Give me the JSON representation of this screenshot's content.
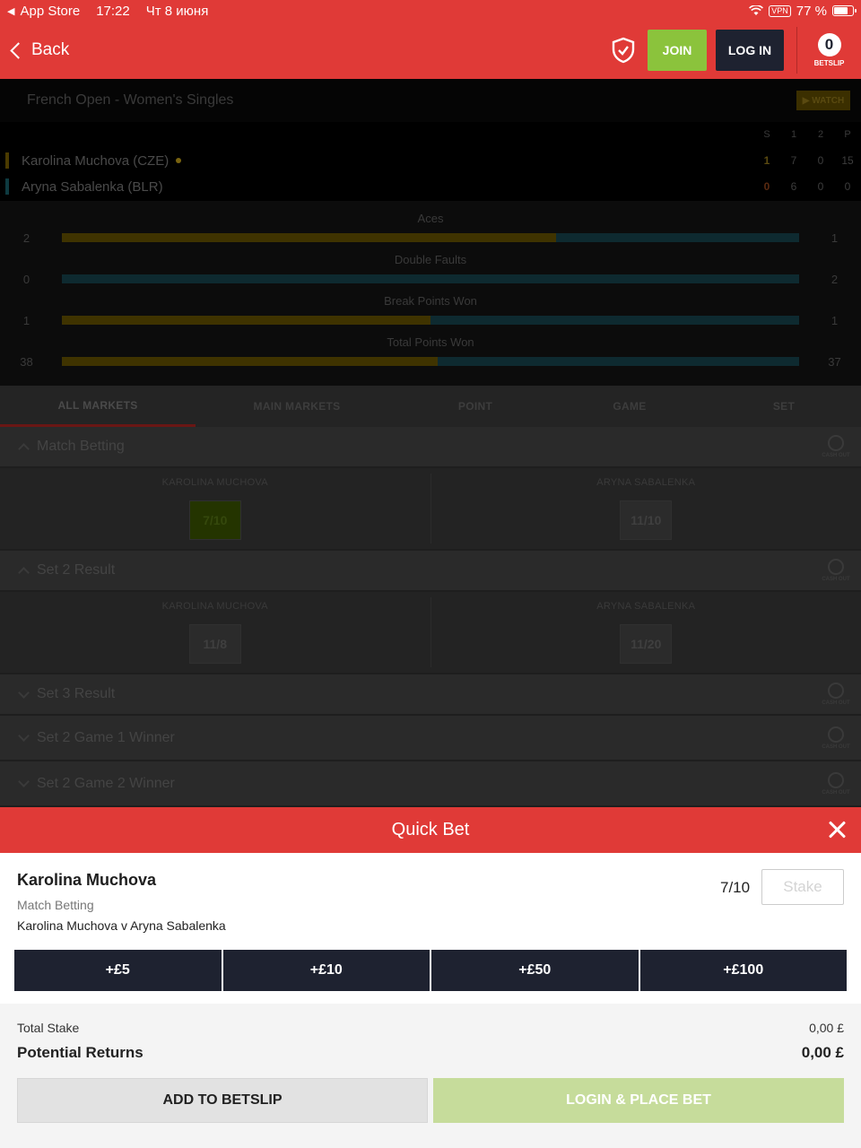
{
  "status_bar": {
    "back_app": "App Store",
    "time": "17:22",
    "date": "Чт 8 июня",
    "vpn": "VPN",
    "battery": "77 %",
    "battery_level": 0.77
  },
  "header": {
    "back_label": "Back",
    "join_label": "JOIN",
    "login_label": "LOG IN",
    "betslip_count": "0",
    "betslip_label": "BETSLIP",
    "brand_color": "#e03a37"
  },
  "scoreboard": {
    "title": "French Open - Women's Singles",
    "watch_label": "▶ WATCH",
    "columns": [
      "S",
      "1",
      "2",
      "P"
    ],
    "players": [
      {
        "name": "Karolina Muchova (CZE)",
        "scores": [
          "1",
          "7",
          "0",
          "15"
        ]
      },
      {
        "name": "Aryna Sabalenka (BLR)",
        "scores": [
          "0",
          "6",
          "0",
          "0"
        ]
      }
    ]
  },
  "stats": [
    {
      "title": "Aces",
      "left": "2",
      "right": "1",
      "left_share": 0.67
    },
    {
      "title": "Double Faults",
      "left": "0",
      "right": "2",
      "left_share": 0.0
    },
    {
      "title": "Break Points Won",
      "left": "1",
      "right": "1",
      "left_share": 0.5
    },
    {
      "title": "Total Points Won",
      "left": "38",
      "right": "37",
      "left_share": 0.51
    }
  ],
  "tabs": [
    "ALL MARKETS",
    "MAIN MARKETS",
    "POINT",
    "GAME",
    "SET"
  ],
  "cashout_label": "CASH OUT",
  "markets": [
    {
      "title": "Match Betting",
      "selections": [
        {
          "name": "KAROLINA MUCHOVA",
          "odds": "7/10"
        },
        {
          "name": "ARYNA SABALENKA",
          "odds": "11/10"
        }
      ]
    },
    {
      "title": "Set 2 Result",
      "selections": [
        {
          "name": "KAROLINA MUCHOVA",
          "odds": "11/8"
        },
        {
          "name": "ARYNA SABALENKA",
          "odds": "11/20"
        }
      ]
    },
    {
      "title": "Set 3 Result"
    },
    {
      "title": "Set 2 Game 1 Winner"
    },
    {
      "title": "Set 2 Game 2 Winner"
    }
  ],
  "quick_bet": {
    "title": "Quick Bet",
    "selection": "Karolina Muchova",
    "market": "Match Betting",
    "event": "Karolina Muchova v Aryna Sabalenka",
    "odds": "7/10",
    "stake_placeholder": "Stake",
    "quick_stakes": [
      "+£5",
      "+£10",
      "+£50",
      "+£100"
    ],
    "total_stake_label": "Total Stake",
    "total_stake_value": "0,00 £",
    "potential_returns_label": "Potential Returns",
    "potential_returns_value": "0,00 £",
    "add_to_betslip_label": "ADD TO BETSLIP",
    "login_place_label": "LOGIN & PLACE BET"
  }
}
